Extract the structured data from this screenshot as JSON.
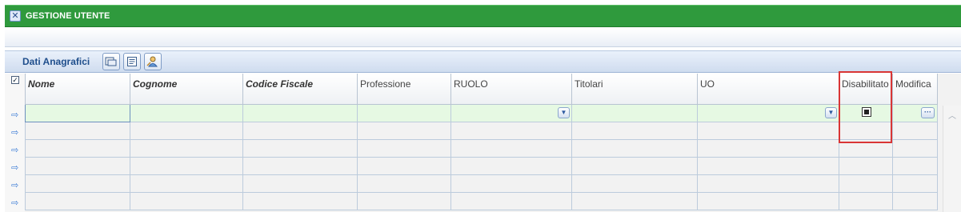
{
  "window": {
    "title": "GESTIONE UTENTE",
    "close_icon": "close-icon"
  },
  "section": {
    "title": "Dati Anagrafici",
    "tools": [
      "open-folder-icon",
      "list-document-icon",
      "user-edit-icon"
    ]
  },
  "grid": {
    "columns": [
      {
        "label": "Nome",
        "style": "bold-italic"
      },
      {
        "label": "Cognome",
        "style": "bold-italic"
      },
      {
        "label": "Codice Fiscale",
        "style": "bold-italic"
      },
      {
        "label": "Professione",
        "style": "normal"
      },
      {
        "label": "RUOLO",
        "style": "normal"
      },
      {
        "label": "Titolari",
        "style": "normal"
      },
      {
        "label": "UO",
        "style": "normal"
      },
      {
        "label": "Disabilitato",
        "style": "normal"
      },
      {
        "label": "Modifica",
        "style": "normal"
      }
    ],
    "rows": 6,
    "first_row": {
      "nome": "",
      "cognome": "",
      "codice_fiscale": "",
      "professione": "",
      "ruolo": "",
      "titolari": "",
      "uo": "",
      "disabilitato": true
    },
    "highlight_color": "#d93535",
    "edit_row_color": "#e6f9e3"
  }
}
